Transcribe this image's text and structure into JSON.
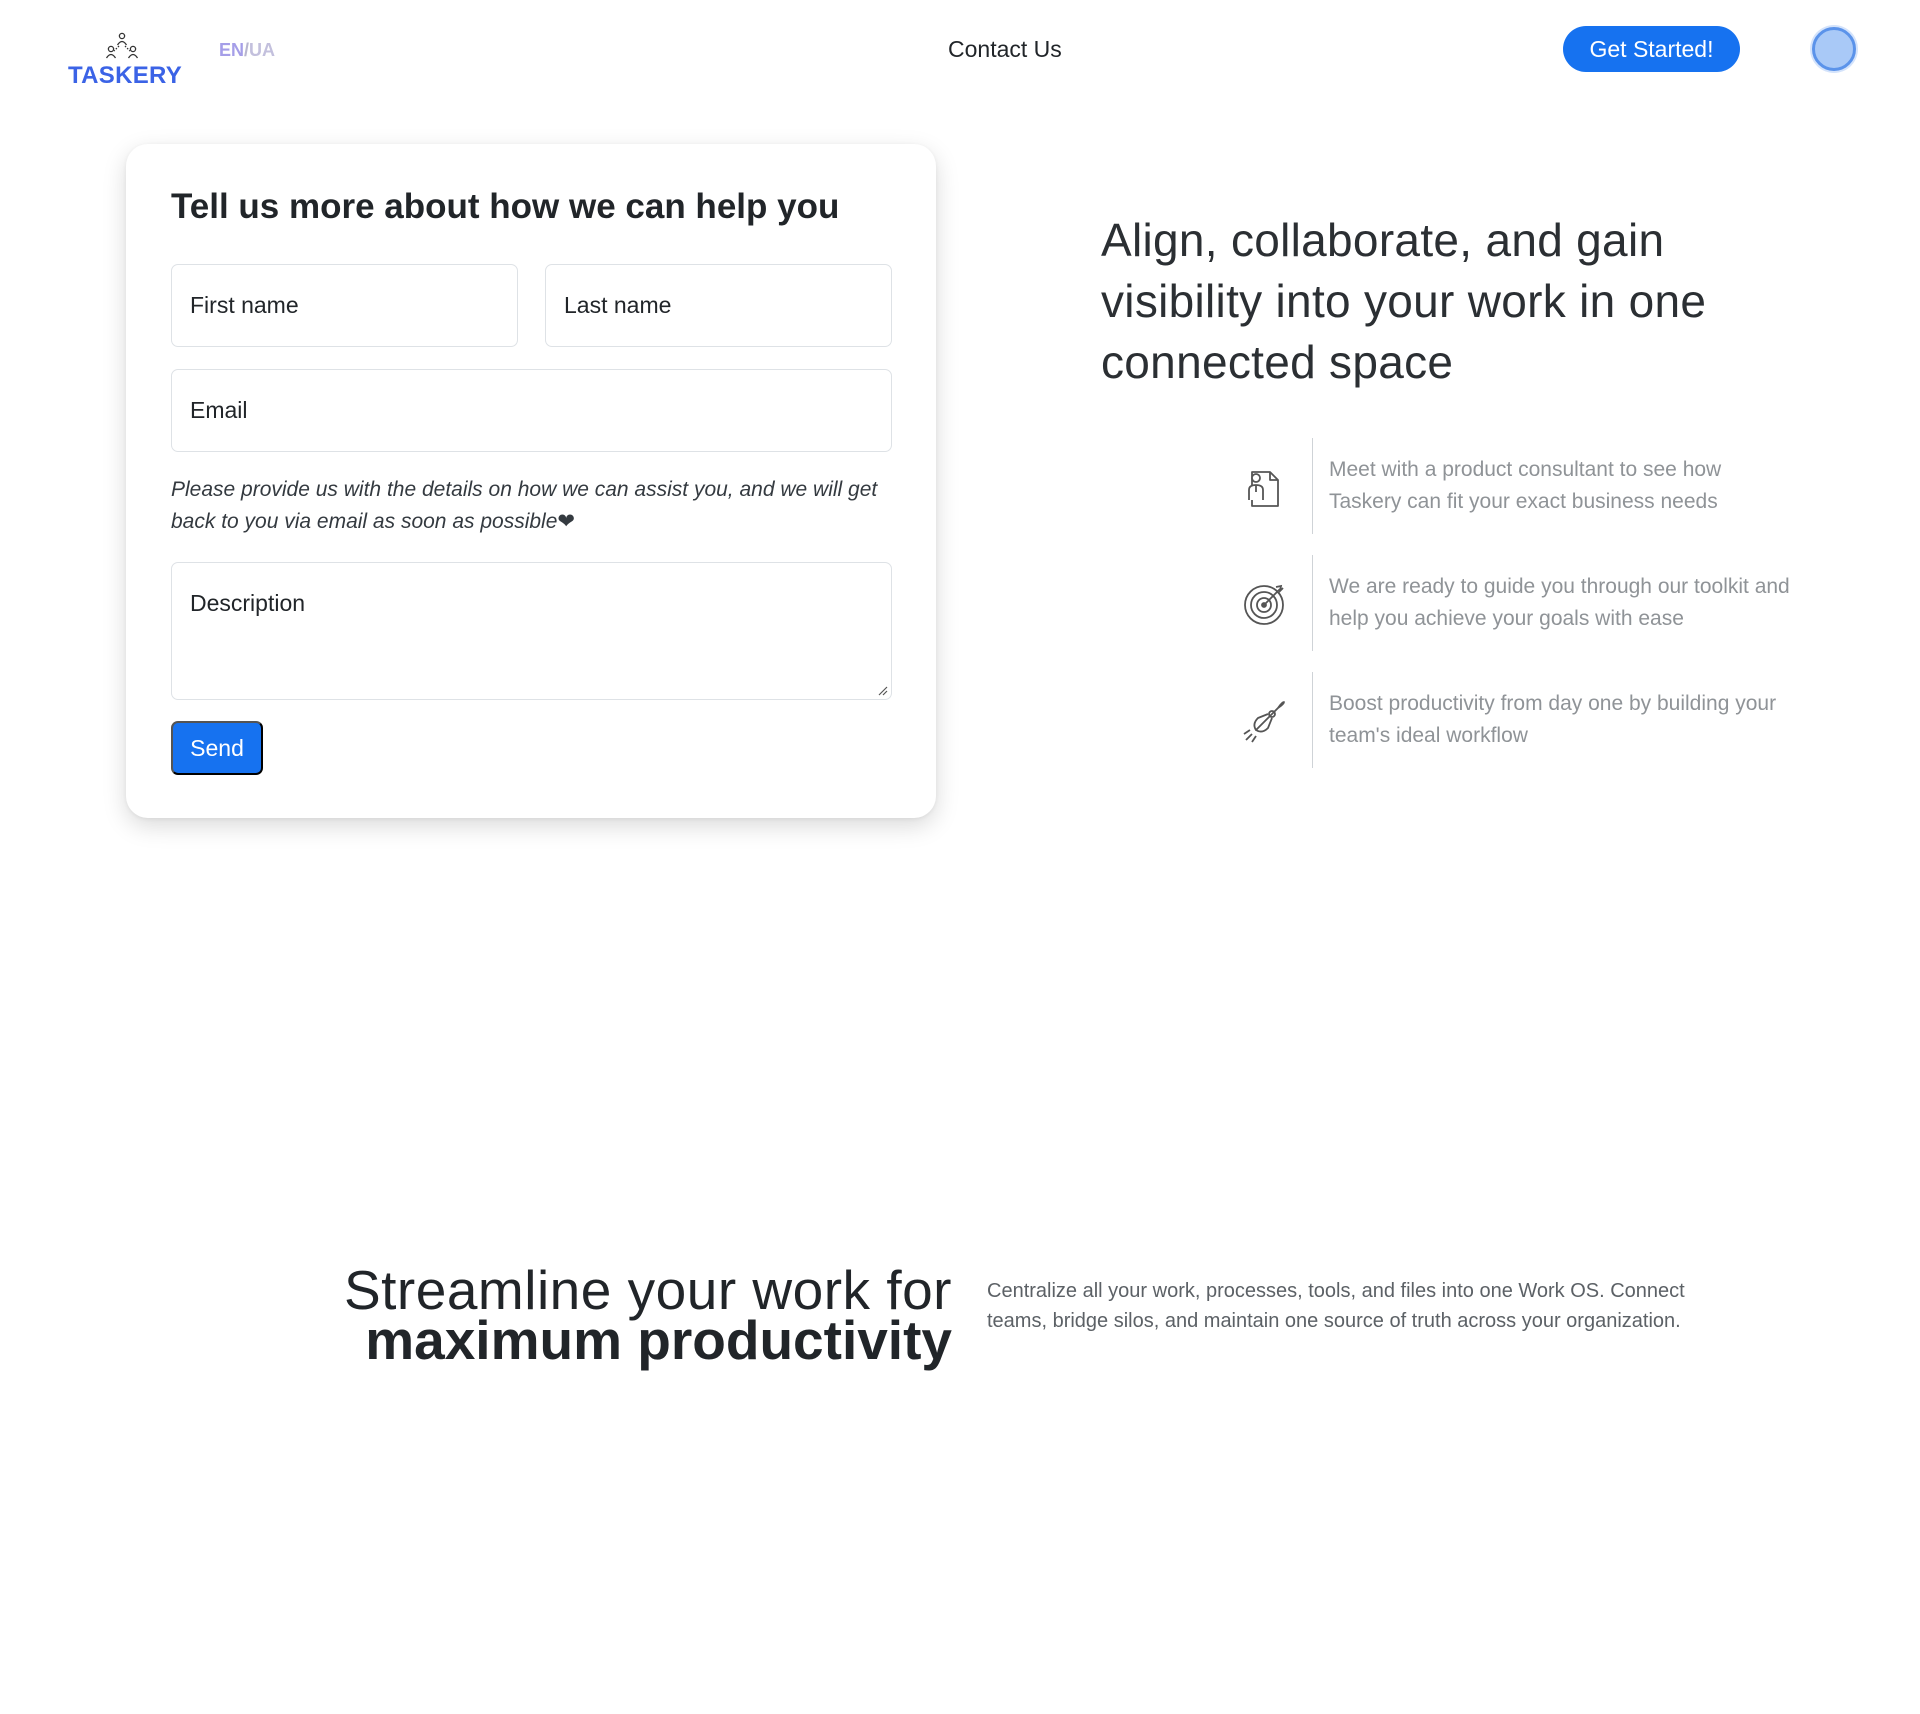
{
  "header": {
    "logo_text": "TASKERY",
    "lang_en": "EN",
    "lang_sep": "/",
    "lang_ua": "UA",
    "nav_contact": "Contact Us",
    "cta_label": "Get Started!"
  },
  "form": {
    "title": "Tell us more about how we can help you",
    "first_name_placeholder": "First name",
    "last_name_placeholder": "Last name",
    "email_placeholder": "Email",
    "help_text": "Please provide us with the details on how we can assist you, and we will get back to you via email as soon as possible❤",
    "description_placeholder": "Description",
    "send_label": "Send"
  },
  "hero": {
    "headline": "Align, collaborate, and gain visibility into your work in one connected space",
    "features": [
      {
        "icon": "consultant-icon",
        "text": "Meet with a product consultant to see how Taskery can fit your exact business needs"
      },
      {
        "icon": "target-icon",
        "text": "We are ready to guide you through our toolkit and help you achieve your goals with ease"
      },
      {
        "icon": "rocket-icon",
        "text": "Boost productivity from day one by building your team's ideal workflow"
      }
    ]
  },
  "streamline": {
    "title_line1": "Streamline your work for",
    "title_line2": "maximum productivity",
    "description": "Centralize all your work, processes, tools, and files into one Work OS. Connect teams, bridge silos, and maintain one source of truth across your organization."
  },
  "colors": {
    "primary": "#1672f0",
    "logo": "#3b63e6",
    "lang_active": "#a59ee8",
    "avatar": "#a9c9f7"
  }
}
